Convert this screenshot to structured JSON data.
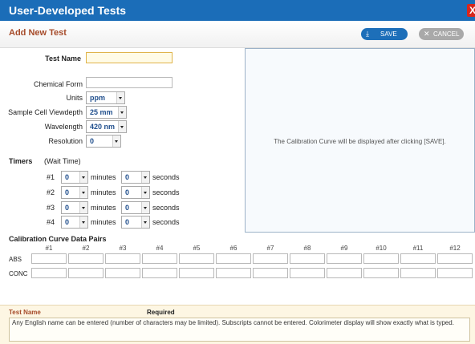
{
  "window": {
    "title": "User-Developed Tests",
    "close_label": "X"
  },
  "header": {
    "subtitle": "Add New Test",
    "save_label": "SAVE",
    "cancel_label": "CANCEL",
    "save_icon": "download-icon",
    "cancel_icon": "x-icon"
  },
  "form": {
    "test_name": {
      "label": "Test Name",
      "value": ""
    },
    "chemical_form": {
      "label": "Chemical Form",
      "value": ""
    },
    "units": {
      "label": "Units",
      "value": "ppm"
    },
    "viewdepth": {
      "label": "Sample Cell Viewdepth",
      "value": "25 mm"
    },
    "wavelength": {
      "label": "Wavelength",
      "value": "420 nm"
    },
    "resolution": {
      "label": "Resolution",
      "value": "0"
    }
  },
  "preview": {
    "message": "The Calibration Curve will be displayed after clicking [SAVE]."
  },
  "timers": {
    "label": "Timers",
    "sublabel": "(Wait Time)",
    "minutes_label": "minutes",
    "seconds_label": "seconds",
    "rows": [
      {
        "label": "#1",
        "minutes": "0",
        "seconds": "0"
      },
      {
        "label": "#2",
        "minutes": "0",
        "seconds": "0"
      },
      {
        "label": "#3",
        "minutes": "0",
        "seconds": "0"
      },
      {
        "label": "#4",
        "minutes": "0",
        "seconds": "0"
      }
    ]
  },
  "calibration": {
    "title": "Calibration Curve Data Pairs",
    "columns": [
      "#1",
      "#2",
      "#3",
      "#4",
      "#5",
      "#6",
      "#7",
      "#8",
      "#9",
      "#10",
      "#11",
      "#12"
    ],
    "row_labels": [
      "ABS",
      "CONC"
    ]
  },
  "help": {
    "field_name": "Test Name",
    "required": "Required",
    "text": "Any English name can be entered (number of characters may be limited). Subscripts cannot be entered. Colorimeter display will show exactly what is typed."
  }
}
